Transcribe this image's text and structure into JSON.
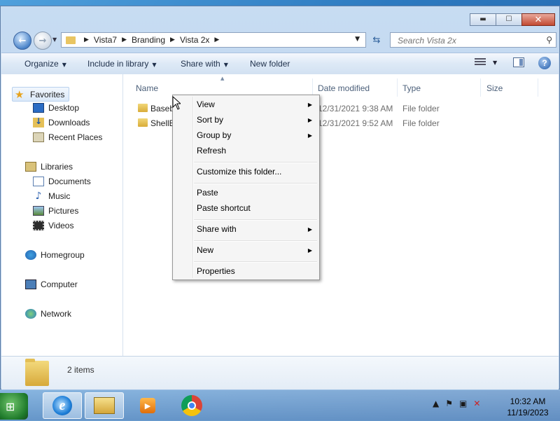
{
  "window": {
    "caption_buttons": {
      "minimize": "▬",
      "maximize": "☐",
      "close": "✕"
    }
  },
  "address_bar": {
    "crumbs": [
      "Vista7",
      "Branding",
      "Vista 2x"
    ],
    "search_placeholder": "Search Vista 2x"
  },
  "command_bar": {
    "organize": "Organize",
    "include_in_library": "Include in library",
    "share_with": "Share with",
    "new_folder": "New folder",
    "help": "?"
  },
  "nav_pane": {
    "favorites": "Favorites",
    "desktop": "Desktop",
    "downloads": "Downloads",
    "recent_places": "Recent Places",
    "libraries": "Libraries",
    "documents": "Documents",
    "music": "Music",
    "pictures": "Pictures",
    "videos": "Videos",
    "homegroup": "Homegroup",
    "computer": "Computer",
    "network": "Network"
  },
  "file_list": {
    "columns": {
      "name": "Name",
      "date_modified": "Date modified",
      "type": "Type",
      "size": "Size"
    },
    "rows": [
      {
        "name": "Baseb",
        "date": "12/31/2021 9:38 AM",
        "type": "File folder"
      },
      {
        "name": "ShellB",
        "date": "12/31/2021 9:52 AM",
        "type": "File folder"
      }
    ]
  },
  "details_pane": {
    "items_count": "2 items"
  },
  "context_menu": {
    "view": "View",
    "sort_by": "Sort by",
    "group_by": "Group by",
    "refresh": "Refresh",
    "customize": "Customize this folder...",
    "paste": "Paste",
    "paste_shortcut": "Paste shortcut",
    "share_with": "Share with",
    "new": "New",
    "properties": "Properties"
  },
  "taskbar": {
    "clock_time": "10:32 AM",
    "clock_date": "11/19/2023"
  }
}
